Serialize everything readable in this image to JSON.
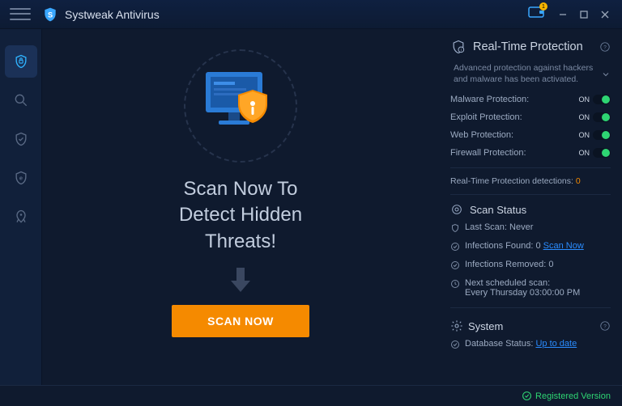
{
  "app": {
    "title": "Systweak Antivirus",
    "walletBadge": "1"
  },
  "center": {
    "headline": "Scan Now To\nDetect Hidden\nThreats!",
    "scanButton": "SCAN NOW"
  },
  "rtp": {
    "title": "Real-Time Protection",
    "desc": "Advanced protection against hackers and malware has been activated.",
    "items": [
      {
        "label": "Malware Protection:",
        "state": "ON"
      },
      {
        "label": "Exploit Protection:",
        "state": "ON"
      },
      {
        "label": "Web Protection:",
        "state": "ON"
      },
      {
        "label": "Firewall Protection:",
        "state": "ON"
      }
    ],
    "detectionsLabel": "Real-Time Protection detections:",
    "detectionsCount": "0"
  },
  "scanStatus": {
    "title": "Scan Status",
    "lastScanLabel": "Last Scan:",
    "lastScanValue": "Never",
    "infectionsFoundLabel": "Infections Found:",
    "infectionsFoundValue": "0",
    "scanNowLink": "Scan Now",
    "infectionsRemovedLabel": "Infections Removed:",
    "infectionsRemovedValue": "0",
    "nextScheduledLabel": "Next scheduled scan:",
    "nextScheduledValue": "Every Thursday 03:00:00 PM"
  },
  "system": {
    "title": "System",
    "dbStatusLabel": "Database Status:",
    "dbStatusValue": "Up to date"
  },
  "footer": {
    "registered": "Registered Version"
  }
}
